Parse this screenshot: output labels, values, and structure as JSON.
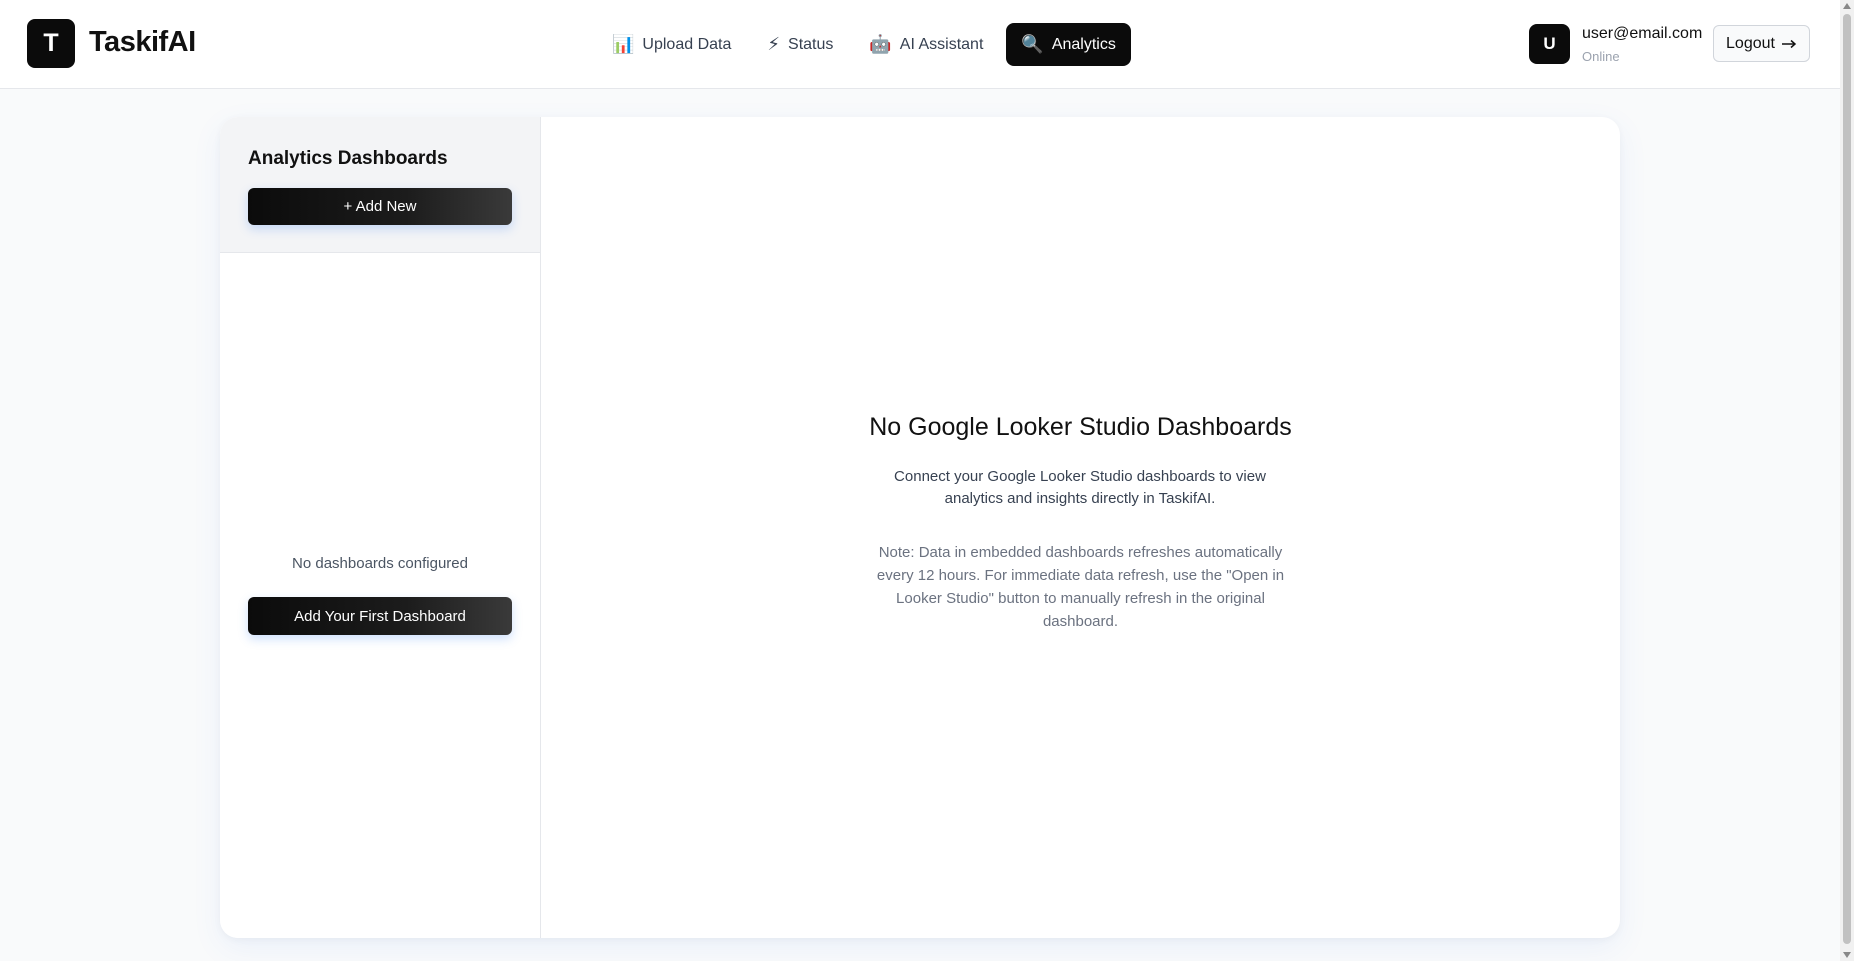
{
  "app": {
    "logo_letter": "T",
    "name": "TaskifAI"
  },
  "nav": {
    "items": [
      {
        "label": "Upload Data",
        "icon": "bar-chart-icon",
        "glyph": "📊"
      },
      {
        "label": "Status",
        "icon": "lightning-icon",
        "glyph": "⚡"
      },
      {
        "label": "AI Assistant",
        "icon": "robot-icon",
        "glyph": "🤖"
      },
      {
        "label": "Analytics",
        "icon": "magnifier-icon",
        "glyph": "🔍",
        "active": true
      }
    ]
  },
  "user": {
    "avatar_letter": "U",
    "email": "user@email.com",
    "status": "Online",
    "logout_label": "Logout",
    "logout_icon": "arrow-right-icon"
  },
  "sidebar": {
    "title": "Analytics Dashboards",
    "add_new_label": "+ Add New",
    "empty_text": "No dashboards configured",
    "add_first_label": "Add Your First Dashboard"
  },
  "main": {
    "title": "No Google Looker Studio Dashboards",
    "description": "Connect your Google Looker Studio dashboards to view analytics and insights directly in TaskifAI.",
    "note": "Note: Data in embedded dashboards refreshes automatically every 12 hours. For immediate data refresh, use the \"Open in Looker Studio\" button to manually refresh in the original dashboard."
  },
  "colors": {
    "primary": "#0b0b0b",
    "background": "#f9fafb",
    "accent_glow": "#3b82f6"
  }
}
